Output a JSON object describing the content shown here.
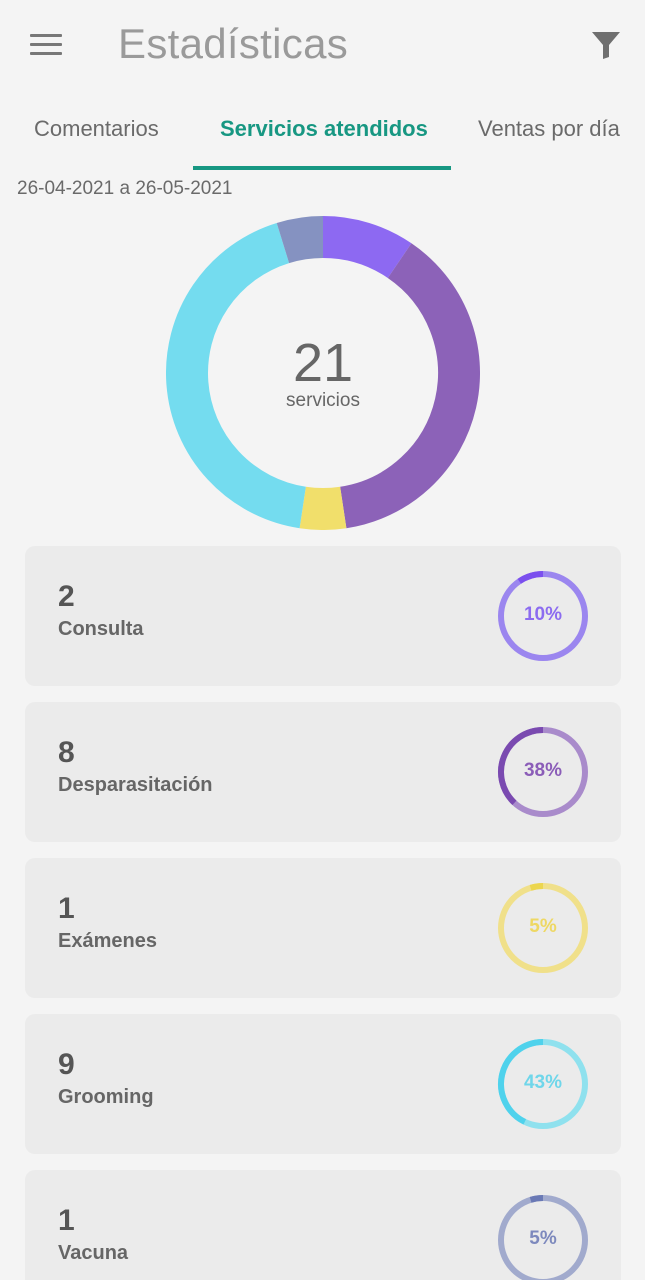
{
  "header": {
    "title": "Estadísticas",
    "menu_icon": "menu-icon",
    "filter_icon": "filter-icon"
  },
  "tabs": [
    {
      "label": "Comentarios",
      "active": false
    },
    {
      "label": "Servicios atendidos",
      "active": true
    },
    {
      "label": "Ventas por día",
      "active": false
    }
  ],
  "date_range": "26-04-2021 a 26-05-2021",
  "summary": {
    "total": "21",
    "unit": "servicios"
  },
  "colors": {
    "accent": "#179782",
    "consulta": "#8d69f2",
    "desparasitacion": "#8c62b8",
    "examenes": "#f1df6b",
    "grooming": "#74dcef",
    "vacuna": "#8592c1"
  },
  "services": [
    {
      "count": "2",
      "name": "Consulta",
      "percent": "10%",
      "value": 2,
      "color": "#8d69f2",
      "ring_color": "#9b86ef",
      "arc_color": "#7b4fee",
      "text_color": "#8c6cf0"
    },
    {
      "count": "8",
      "name": "Desparasitación",
      "percent": "38%",
      "value": 8,
      "color": "#8c62b8",
      "ring_color": "#a98bcb",
      "arc_color": "#7a4ab0",
      "text_color": "#8b5db8"
    },
    {
      "count": "1",
      "name": "Exámenes",
      "percent": "5%",
      "value": 1,
      "color": "#f1df6b",
      "ring_color": "#f0e08a",
      "arc_color": "#ecd64e",
      "text_color": "#eed864"
    },
    {
      "count": "9",
      "name": "Grooming",
      "percent": "43%",
      "value": 9,
      "color": "#74dcef",
      "ring_color": "#8fe1ee",
      "arc_color": "#4fd2ec",
      "text_color": "#6fd6ea"
    },
    {
      "count": "1",
      "name": "Vacuna",
      "percent": "5%",
      "value": 1,
      "color": "#8592c1",
      "ring_color": "#a1aacd",
      "arc_color": "#6a79b5",
      "text_color": "#7d89bd"
    }
  ],
  "donut_order": [
    0,
    1,
    2,
    3,
    4
  ]
}
